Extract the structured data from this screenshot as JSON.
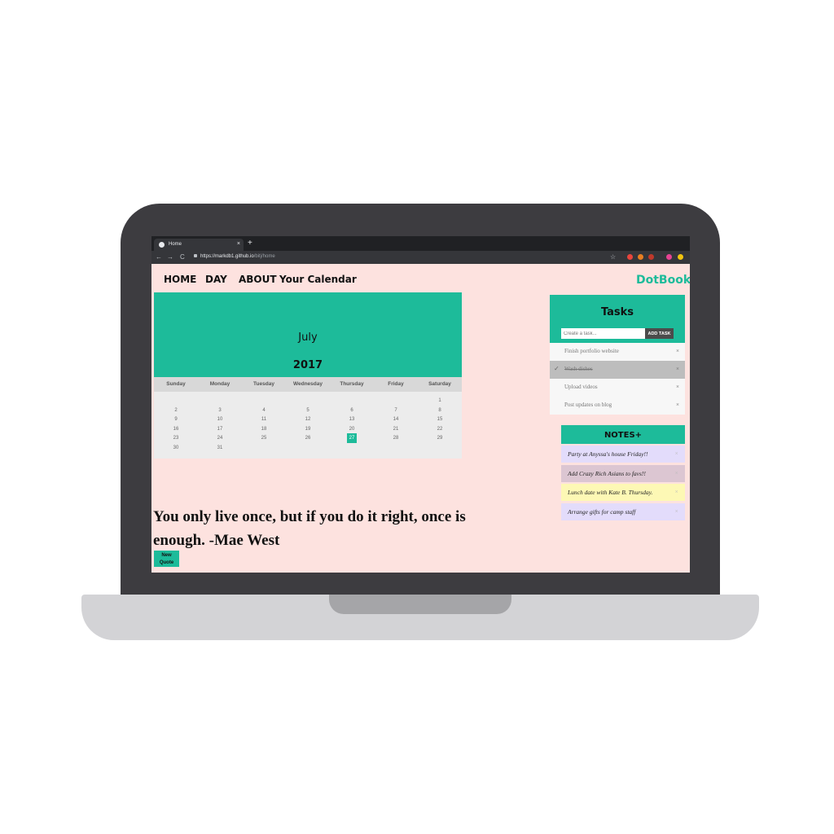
{
  "browser": {
    "tab_title": "Home",
    "tab_close": "×",
    "new_tab": "+",
    "back": "←",
    "forward": "→",
    "reload": "C",
    "url_host": "https://markdb1.github.io",
    "url_path": "/bitj/home",
    "star": "☆",
    "extension_colors": [
      "#e8453c",
      "#e67e22",
      "#c0392b",
      "#e84393",
      "#f1c40f"
    ]
  },
  "nav": {
    "home": "HOME",
    "day": "DAY",
    "about": "ABOUT",
    "calendar": "Your Calendar",
    "brand": "DotBook"
  },
  "calendar": {
    "month": "July",
    "year": "2017",
    "weekdays": [
      "Sunday",
      "Monday",
      "Tuesday",
      "Wednesday",
      "Thursday",
      "Friday",
      "Saturday"
    ],
    "first_weekday_index": 6,
    "days_in_month": 31,
    "today": 27
  },
  "quote": {
    "text": "You only live once, but if you do it right, once is enough. -Mae West",
    "button": "New Quote"
  },
  "tasks": {
    "title": "Tasks",
    "input_placeholder": "Create a task...",
    "add_button": "ADD TASK",
    "close_glyph": "×",
    "check_glyph": "✓",
    "items": [
      {
        "text": "Finish portfolio website",
        "done": false
      },
      {
        "text": "Wash dishes",
        "done": true
      },
      {
        "text": "Upload videos",
        "done": false
      },
      {
        "text": "Post updates on blog",
        "done": false
      }
    ]
  },
  "notes": {
    "title": "NOTES+",
    "close_glyph": "×",
    "items": [
      {
        "text": "Party at Anyssa's house Friday!!",
        "color": "#e3dcfb"
      },
      {
        "text": "Add Crazy Rich Asians to favs!!",
        "color": "#dcc6d2"
      },
      {
        "text": "Lunch date with Kate B. Thursday.",
        "color": "#fdf8b5"
      },
      {
        "text": "Arrange gifts for camp staff",
        "color": "#e3dcfb"
      }
    ]
  }
}
